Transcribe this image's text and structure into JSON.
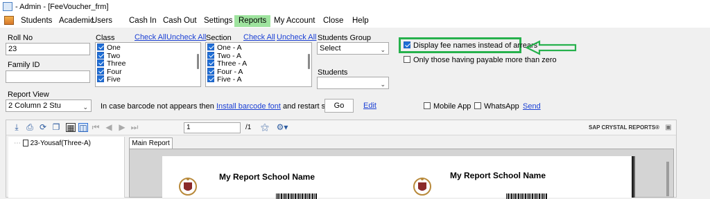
{
  "window": {
    "title": "- Admin - [FeeVoucher_frm]"
  },
  "menu": {
    "items": [
      "Students",
      "Academic",
      "Users",
      "Cash In",
      "Cash Out",
      "Settings",
      "Reports",
      "My Account",
      "Close",
      "Help"
    ],
    "active": "Reports"
  },
  "form": {
    "roll_no": {
      "label": "Roll No",
      "value": "23"
    },
    "family_id": {
      "label": "Family ID",
      "value": ""
    },
    "class": {
      "label": "Class",
      "check_all": "Check All",
      "uncheck_all": "Uncheck All",
      "items": [
        "One",
        "Two",
        "Three",
        "Four",
        "Five"
      ]
    },
    "section": {
      "label": "Section",
      "check_all": "Check All",
      "uncheck_all": "Uncheck All",
      "items": [
        "One - A",
        "Two - A",
        "Three - A",
        "Four - A",
        "Five - A"
      ]
    },
    "students_group": {
      "label": "Students Group",
      "value": "Select"
    },
    "students": {
      "label": "Students",
      "value": ""
    },
    "display_fee_names": {
      "label": "Display fee names instead of arrears",
      "checked": true
    },
    "only_payable": {
      "label": "Only those having payable more than zero",
      "checked": false
    },
    "report_view": {
      "label": "Report View",
      "value": "2 Column 2 Stu"
    },
    "barcode_note_prefix": "In case barcode not appears then",
    "barcode_link": "Install barcode font",
    "barcode_note_suffix": "and restart software",
    "go_button": "Go",
    "edit_link": "Edit",
    "mobile_app": {
      "label": "Mobile App",
      "checked": false
    },
    "whatsapp": {
      "label": "WhatsApp",
      "checked": false
    },
    "send_link": "Send"
  },
  "viewer": {
    "page_input": "1",
    "page_total": "/1",
    "brand": "SAP CRYSTAL REPORTS®",
    "tree_item": "23-Yousaf(Three-A)",
    "tab": "Main Report",
    "school_name_left": "My Report School Name",
    "school_name_right": "My Report School Name"
  },
  "colors": {
    "highlight_green": "#26b14c",
    "active_menu": "#9ee39e",
    "link": "#1a3fd4"
  }
}
